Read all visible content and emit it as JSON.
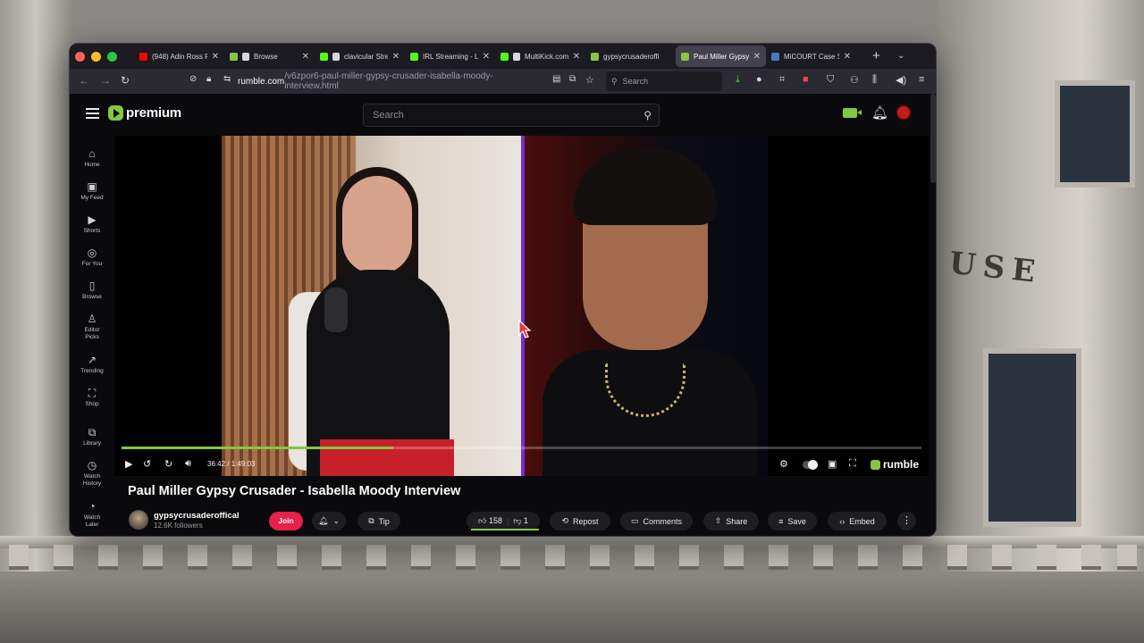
{
  "tabs": [
    {
      "title": "(948) Adin Ross Fi",
      "favicon_color": "#ff0000",
      "active": false
    },
    {
      "title": "Browse",
      "favicon_color": "#85c742",
      "active": false,
      "muted": true
    },
    {
      "title": "clavicular Stre",
      "favicon_color": "#53fc18",
      "active": false,
      "muted": true
    },
    {
      "title": "IRL Streaming - Li",
      "favicon_color": "#53fc18",
      "active": false
    },
    {
      "title": "MultiKick.com",
      "favicon_color": "#53fc18",
      "active": false,
      "muted": true
    },
    {
      "title": "gypsycrusaderoffi",
      "favicon_color": "#85c742",
      "active": false
    },
    {
      "title": "Paul Miller Gypsy",
      "favicon_color": "#85c742",
      "active": true
    },
    {
      "title": "MiCOURT Case Se",
      "favicon_color": "#4a78c8",
      "active": false
    }
  ],
  "navbar": {
    "url_host": "rumble.com",
    "url_path": "/v6zpor6-paul-miller-gypsy-crusader-isabella-moody-interview.html",
    "search_placeholder": "Search",
    "download_icon": "download-icon",
    "bookmark_icon": "star-icon"
  },
  "header": {
    "logo_text": "premium",
    "search_placeholder": "Search",
    "accent": "#85c742"
  },
  "sidebar": {
    "items": [
      {
        "label": "Home",
        "icon": "home-icon"
      },
      {
        "label": "My Feed",
        "icon": "feed-icon"
      },
      {
        "label": "Shorts",
        "icon": "shorts-icon"
      },
      {
        "label": "For You",
        "icon": "for-you-icon"
      },
      {
        "label": "Browse",
        "icon": "browse-icon"
      },
      {
        "label": "Editor Picks",
        "icon": "editor-picks-icon"
      },
      {
        "label": "Trending",
        "icon": "trending-icon"
      },
      {
        "label": "Shop",
        "icon": "shop-icon"
      },
      {
        "label": "Library",
        "icon": "library-icon"
      },
      {
        "label": "Watch History",
        "icon": "history-icon"
      },
      {
        "label": "Watch Later",
        "icon": "clock-icon"
      }
    ]
  },
  "player": {
    "time": "36:42 / 1:49:03",
    "progress": 0.34,
    "brand": "rumble"
  },
  "video": {
    "title": "Paul Miller Gypsy Crusader - Isabella Moody Interview",
    "channel": "gypsycrusaderoffical",
    "followers": "12.6K followers",
    "join": "Join",
    "tip": "Tip",
    "likes": "158",
    "dislikes": "1",
    "repost": "Repost",
    "comments": "Comments",
    "share": "Share",
    "save": "Save",
    "embed": "Embed"
  }
}
